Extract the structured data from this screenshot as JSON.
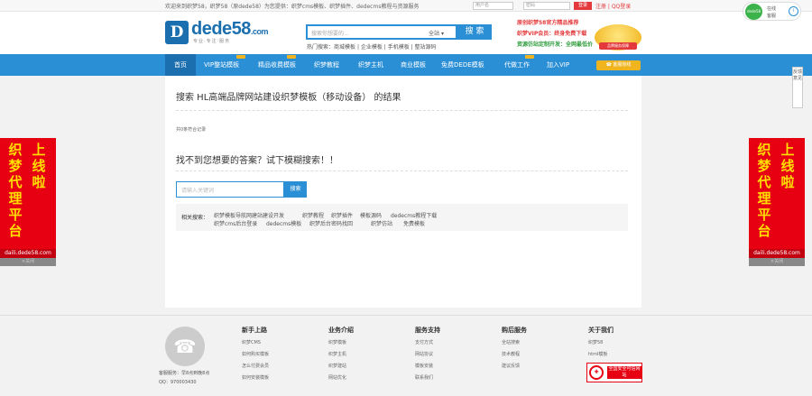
{
  "topbar": {
    "notice": "欢迎来到织梦58，织梦58（原dede58）为您提供：织梦cms模板、织梦插件、dedecms教程与资源服务",
    "user_placeholder": "用户名",
    "pass_placeholder": "密码",
    "login": "登录",
    "register": "注册 | QQ登录"
  },
  "header": {
    "logo_mark": "D",
    "logo_name": "dede",
    "logo_num": "58",
    "logo_suffix": ".com",
    "logo_sub": "专业·专注·服务",
    "search_placeholder": "搜索你想要的...",
    "search_category": "全站",
    "search_button": "搜 索",
    "hot_label": "热门搜索",
    "hot_words": "商城模板 | 企业模板 | 手机模板 | 整站源码",
    "promo1": "原创织梦58官方精品推荐",
    "promo2": "织梦VIP会员：终身免费下载",
    "promo3": "资源仿站定制开发：全网最低价",
    "badge": "品牌服务保障"
  },
  "nav": {
    "items": [
      "首页",
      "VIP整站模板",
      "精品收费模板",
      "织梦教程",
      "织梦主机",
      "商业模板",
      "免费DEDE模板",
      "代做工作",
      "加入VIP"
    ],
    "right_button": "☎ 客服热线"
  },
  "main": {
    "title": "搜索 HL高端品牌网站建设织梦模板（移动设备） 的结果",
    "count": "共0条符合记录",
    "suggest": "找不到您想要的答案？试下模糊搜索！！",
    "input_placeholder": "请输入关键词",
    "search_button": "搜索",
    "related_label": "相关搜索：",
    "related_row1": [
      "织梦模板导航网建站建设开发",
      "织梦教程",
      "织梦插件",
      "模板源码",
      "dedecms教程下载"
    ],
    "related_row2": [
      "织梦cms后台登录",
      "dedecms模板",
      "织梦后台密码找回",
      "织梦仿站",
      "免费模板"
    ]
  },
  "ads": {
    "left_col1": "上线啦",
    "left_col2": "织梦代理平台",
    "url": "daili.dede58.com",
    "close": "×关闭"
  },
  "side_tool": "反馈意见",
  "widget": {
    "ball": "dede58",
    "line1": "在线",
    "line2": "客服",
    "icon": "i"
  },
  "footer": {
    "service_hours": "客服服务：早8点到晚8点",
    "qq": "QQ：970003430",
    "columns": [
      {
        "title": "新手上路",
        "links": [
          "织梦CMS",
          "如何购买模板",
          "怎么付费会员",
          "如何安装模板"
        ]
      },
      {
        "title": "业务介绍",
        "links": [
          "织梦模板",
          "织梦主机",
          "织梦建站",
          "网站优化"
        ]
      },
      {
        "title": "服务支持",
        "links": [
          "支付方式",
          "网站协议",
          "模板安装",
          "联系我们"
        ]
      },
      {
        "title": "购后服务",
        "links": [
          "全站搜索",
          "技术教程",
          "建议反馈"
        ]
      },
      {
        "title": "关于我们",
        "links": [
          "织梦58",
          "html模板"
        ]
      }
    ],
    "seal": "全国安全可信网站"
  }
}
